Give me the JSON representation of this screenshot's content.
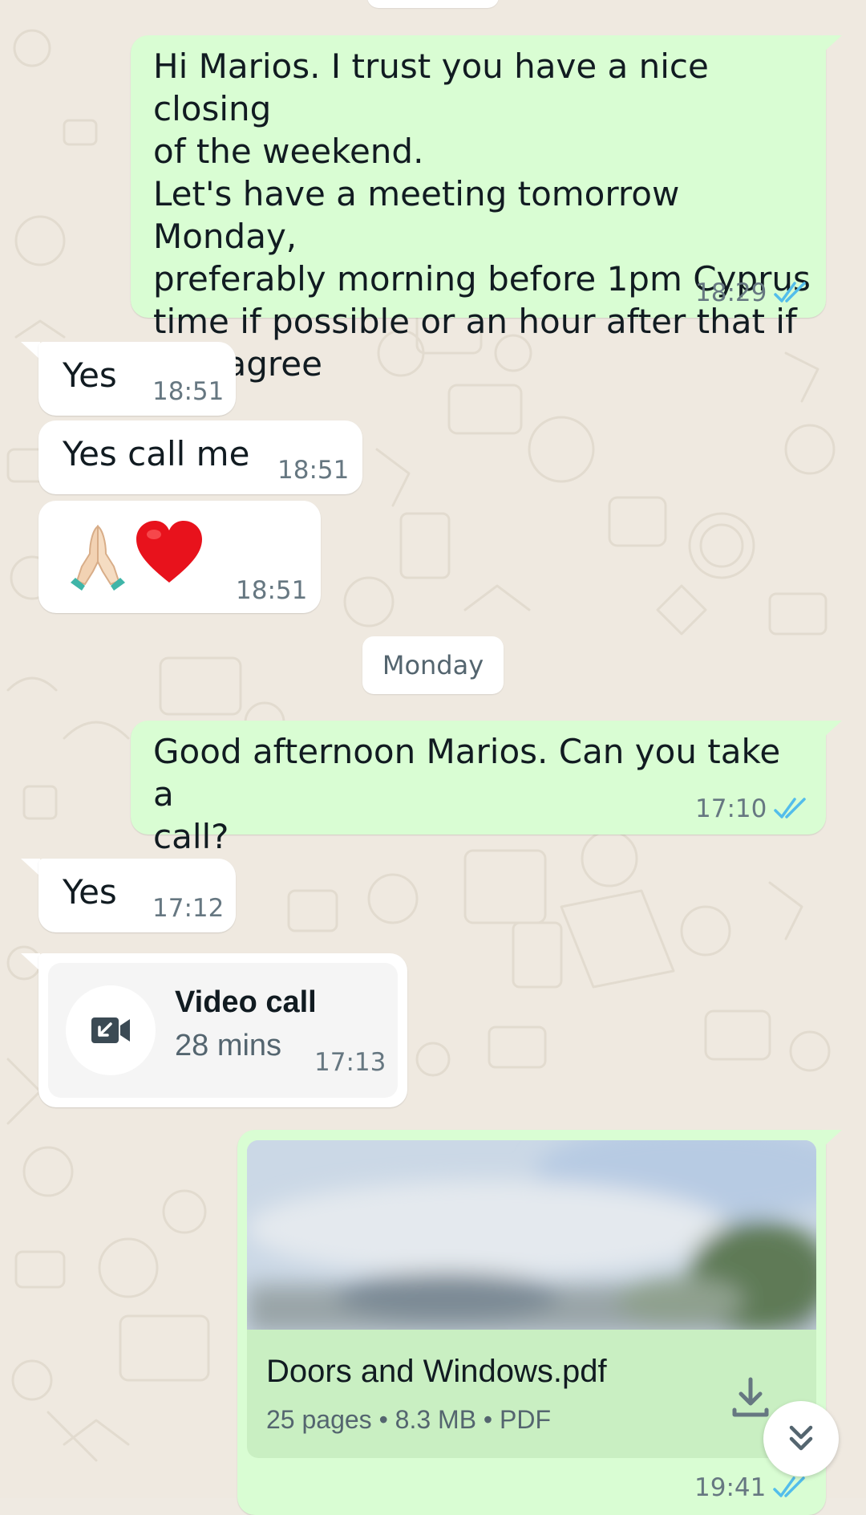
{
  "messages": {
    "m1": {
      "text": "Hi Marios. I trust you have a nice closing\nof the weekend.\nLet's have a meeting tomorrow Monday,\npreferably morning before 1pm Cyprus\ntime if possible or an hour after that if\nyou agree",
      "time": "18:29",
      "status": "read"
    },
    "m2": {
      "text": "Yes",
      "time": "18:51"
    },
    "m3": {
      "text": "Yes call me",
      "time": "18:51"
    },
    "m4": {
      "text": "🙏🏻❤️",
      "time": "18:51"
    },
    "date_chip": "Monday",
    "m5": {
      "text": "Good afternoon Marios. Can you take a\ncall?",
      "time": "17:10",
      "status": "read"
    },
    "m6": {
      "text": "Yes",
      "time": "17:12"
    },
    "m7": {
      "title": "Video call",
      "duration": "28 mins",
      "time": "17:13",
      "icon": "missed-video-call-icon"
    },
    "m8": {
      "file_name": "Doors and Windows.pdf",
      "meta": "25 pages • 8.3 MB • PDF",
      "time": "19:41",
      "status": "read"
    }
  },
  "colors": {
    "outgoing_bubble": "#d9fdd3",
    "incoming_bubble": "#ffffff",
    "read_ticks": "#53bdeb",
    "background": "#efe9e0"
  },
  "icons": {
    "scroll_down": "double-chevron-down-icon",
    "download": "download-icon"
  }
}
